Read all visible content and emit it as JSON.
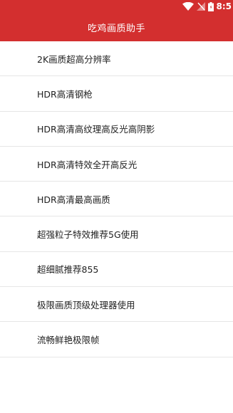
{
  "status_bar": {
    "time": "8:5",
    "icons": [
      "wifi-icon",
      "no-signal-icon",
      "battery-icon"
    ]
  },
  "app_bar": {
    "title": "吃鸡画质助手"
  },
  "list": {
    "items": [
      {
        "label": "2K画质超高分辨率"
      },
      {
        "label": "HDR高清钢枪"
      },
      {
        "label": "HDR高清高纹理高反光高阴影"
      },
      {
        "label": "HDR高清特效全开高反光"
      },
      {
        "label": "HDR高清最高画质"
      },
      {
        "label": "超强粒子特效推荐5G使用"
      },
      {
        "label": "超细腻推荐855"
      },
      {
        "label": "极限画质顶级处理器使用"
      },
      {
        "label": "流畅鲜艳极限帧"
      }
    ]
  },
  "colors": {
    "primary": "#d32f2f",
    "text": "#222222",
    "divider": "#e6e6e6",
    "background": "#ffffff"
  }
}
